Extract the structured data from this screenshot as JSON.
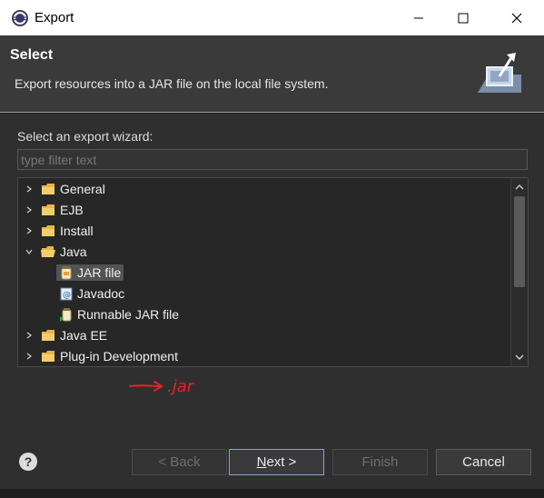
{
  "window": {
    "title": "Export",
    "minimize_icon": "minimize-icon",
    "maximize_icon": "maximize-icon",
    "close_icon": "close-icon"
  },
  "header": {
    "title": "Select",
    "description": "Export resources into a JAR file on the local file system."
  },
  "filter": {
    "label": "Select an export wizard:",
    "placeholder": "type filter text",
    "value": ""
  },
  "tree": {
    "items": [
      {
        "label": "General",
        "expanded": false,
        "icon": "folder-icon"
      },
      {
        "label": "EJB",
        "expanded": false,
        "icon": "folder-icon"
      },
      {
        "label": "Install",
        "expanded": false,
        "icon": "folder-icon"
      },
      {
        "label": "Java",
        "expanded": true,
        "icon": "folder-open-icon"
      },
      {
        "label": "JAR file",
        "selected": true,
        "icon": "jar-icon"
      },
      {
        "label": "Javadoc",
        "icon": "javadoc-icon"
      },
      {
        "label": "Runnable JAR file",
        "icon": "runnable-jar-icon"
      },
      {
        "label": "Java EE",
        "expanded": false,
        "icon": "folder-icon"
      },
      {
        "label": "Plug-in Development",
        "expanded": false,
        "icon": "folder-icon"
      }
    ]
  },
  "annotation": {
    "text": ".jar",
    "color": "#e0242a"
  },
  "buttons": {
    "back": "< Back",
    "next_pre": "",
    "next_underlined": "N",
    "next_post": "ext >",
    "finish": "Finish",
    "cancel": "Cancel"
  },
  "colors": {
    "accent": "#7fa7d8",
    "background": "#2f2f2f"
  }
}
